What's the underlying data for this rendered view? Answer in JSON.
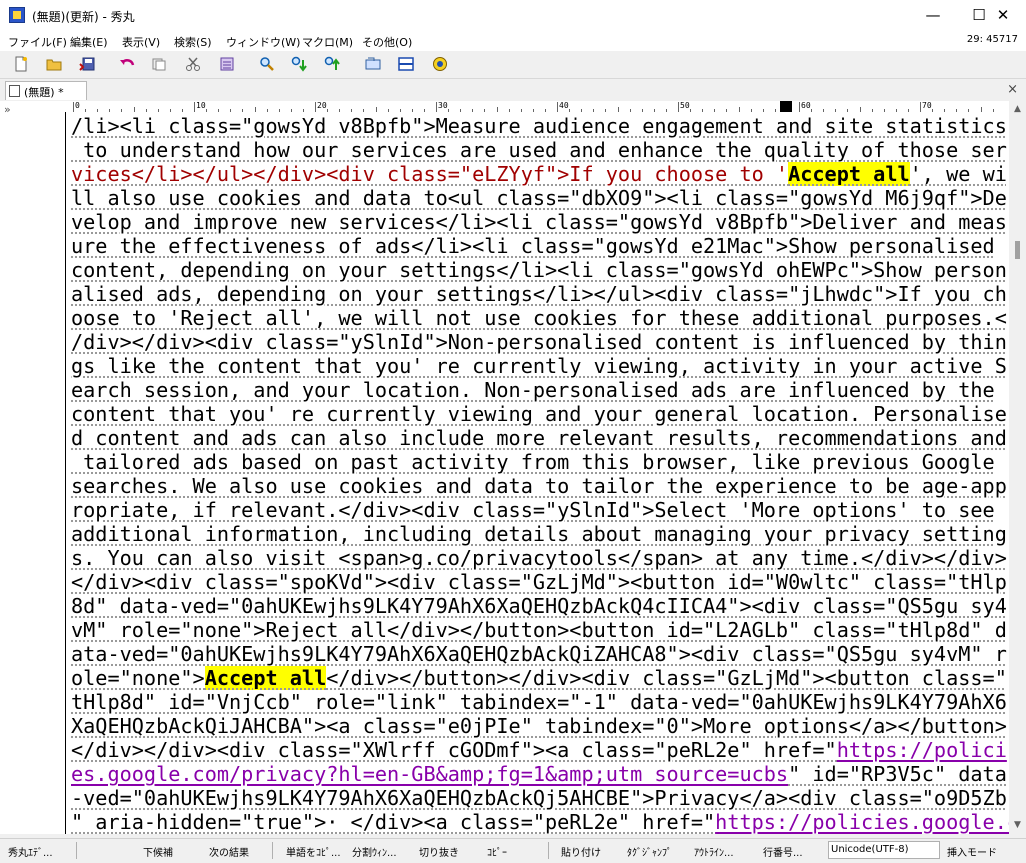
{
  "window": {
    "title": "(無題)(更新) - 秀丸",
    "minimize": "—",
    "maximize": "☐",
    "close": "✕"
  },
  "menu": {
    "items": [
      "ファイル(F)",
      "編集(E)",
      "表示(V)",
      "検索(S)",
      "ウィンドウ(W)",
      "マクロ(M)",
      "その他(O)"
    ],
    "position": "29: 45717"
  },
  "toolbar": {
    "icons": [
      "new-file-icon",
      "open-folder-icon",
      "save-icon",
      "undo-icon",
      "copy-icon",
      "cut-icon",
      "paste-icon",
      "find-icon",
      "find-down-icon",
      "find-up-icon",
      "grep-icon",
      "split-window-icon",
      "hidemaru-assist-icon"
    ]
  },
  "tab": {
    "label": "(無題) *",
    "close": "×"
  },
  "ruler": {
    "labels": [
      "0",
      "10",
      "20",
      "30",
      "40",
      "50",
      "60",
      "70"
    ]
  },
  "editor": {
    "lines": [
      "/li><li class=\"gowsYd v8Bpfb\">Measure audience engagement and site statistics",
      " to understand how our services are used and enhance the quality of those ser",
      "vices</li></ul></div><div class=\"eLZYyf\">If you choose to '",
      "Accept all",
      "', we wi",
      "ll also use cookies and data to<ul class=\"dbXO9\"><li class=\"gowsYd M6j9qf\">De",
      "velop and improve new services</li><li class=\"gowsYd v8Bpfb\">Deliver and meas",
      "ure the effectiveness of ads</li><li class=\"gowsYd e21Mac\">Show personalised",
      "content, depending on your settings</li><li class=\"gowsYd ohEWPc\">Show person",
      "alised ads, depending on your settings</li></ul><div class=\"jLhwdc\">If you ch",
      "oose to 'Reject all', we will not use cookies for these additional purposes.<",
      "/div></div><div class=\"ySlnId\">Non-personalised content is influenced by thin",
      "gs like the content that you' re currently viewing, activity in your active S",
      "earch session, and your location. Non-personalised ads are influenced by the",
      "content that you' re currently viewing and your general location. Personalise",
      "d content and ads can also include more relevant results, recommendations and",
      " tailored ads based on past activity from this browser, like previous Google",
      "searches. We also use cookies and data to tailor the experience to be age-app",
      "ropriate, if relevant.</div><div class=\"ySlnId\">Select 'More options' to see",
      "additional information, including details about managing your privacy setting",
      "s. You can also visit <span>g.co/privacytools</span> at any time.</div></div>",
      "</div><div class=\"spoKVd\"><div class=\"GzLjMd\"><button id=\"W0wltc\" class=\"tHlp",
      "8d\" data-ved=\"0ahUKEwjhs9LK4Y79AhX6XaQEHQzbAckQ4cIICA4\"><div class=\"QS5gu sy4",
      "vM\" role=\"none\">Reject all</div></button><button id=\"L2AGLb\" class=\"tHlp8d\" d",
      "ata-ved=\"0ahUKEwjhs9LK4Y79AhX6XaQEHQzbAckQiZAHCA8\"><div class=\"QS5gu sy4vM\" r",
      "ole=\"none\">",
      "Accept all",
      "</div></button></div><div class=\"GzLjMd\"><button class=\"",
      "tHlp8d\" id=\"VnjCcb\" role=\"link\" tabindex=\"-1\" data-ved=\"0ahUKEwjhs9LK4Y79AhX6",
      "XaQEHQzbAckQiJAHCBA\"><a class=\"e0jPIe\" tabindex=\"0\">More options</a></button>",
      "</div></div><div class=\"XWlrff cGODmf\"><a class=\"peRL2e\" href=\"",
      "https://polici",
      "es.google.com/privacy?hl=en-GB&amp;fg=1&amp;utm_source=ucbs",
      "\" id=\"RP3V5c\" data",
      "-ved=\"0ahUKEwjhs9LK4Y79AhX6XaQEHQzbAckQj5AHCBE\">Privacy</a><div class=\"o9D5Zb",
      "\" aria-hidden=\"true\">· </div><a class=\"peRL2e\" href=\"",
      "https://policies.google.c"
    ]
  },
  "statusbar": {
    "items": [
      "秀丸ｴﾃﾞ...",
      "下候補",
      "次の結果",
      "単語をｺﾋﾟ...",
      "分割ｳｨﾝ...",
      "切り抜き",
      "ｺﾋﾟｰ",
      "貼り付け",
      "ﾀｸﾞｼﾞｬﾝﾌﾟ",
      "ｱｳﾄﾗｲﾝ...",
      "行番号...",
      "挿入モード"
    ],
    "encoding": "Unicode(UTF-8)"
  },
  "colors": {
    "highlight": "#ffff00",
    "string_red": "#a00000",
    "link_purple": "#8800aa"
  }
}
